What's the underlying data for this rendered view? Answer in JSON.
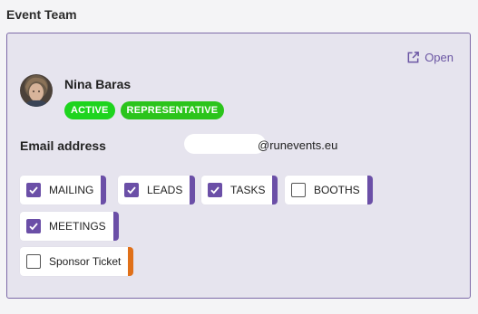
{
  "section_title": "Event Team",
  "open_link": {
    "label": "Open",
    "icon": "external-link-icon"
  },
  "member": {
    "name": "Nina Baras",
    "avatar_icon": "avatar-photo",
    "badges": [
      {
        "label": "ACTIVE",
        "color": "#1ed41e"
      },
      {
        "label": "REPRESENTATIVE",
        "color": "#2bc41b"
      }
    ]
  },
  "email": {
    "label": "Email address",
    "domain": "@runevents.eu"
  },
  "permissions": [
    {
      "label": "MAILING",
      "checked": true,
      "accent": "#6b4fa7"
    },
    {
      "label": "LEADS",
      "checked": true,
      "accent": "#6b4fa7"
    },
    {
      "label": "TASKS",
      "checked": true,
      "accent": "#6b4fa7"
    },
    {
      "label": "BOOTHS",
      "checked": false,
      "accent": "#6b4fa7"
    },
    {
      "label": "MEETINGS",
      "checked": true,
      "accent": "#6b4fa7"
    },
    {
      "label": "Sponsor Ticket",
      "checked": false,
      "accent": "#e07019"
    }
  ],
  "colors": {
    "accent": "#6b56a3",
    "card_background": "#e6e4ee",
    "card_border": "#7d6aa8"
  }
}
